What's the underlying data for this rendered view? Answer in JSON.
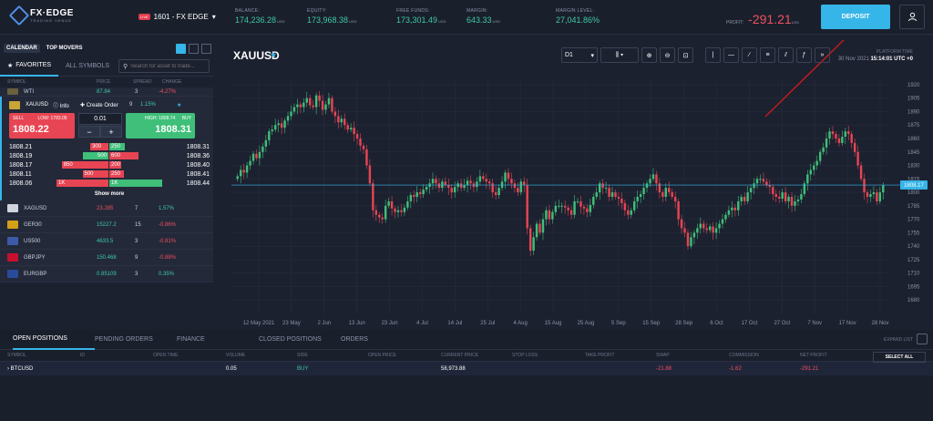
{
  "header": {
    "logo": "FX·EDGE",
    "logo_sub": "TRADING VENUE",
    "live_badge": "LIVE",
    "account": "1601 - FX EDGE",
    "balance_label": "BALANCE:",
    "balance": "174,236.28",
    "equity_label": "EQUITY:",
    "equity": "173,968.38",
    "free_funds_label": "FREE FUNDS:",
    "free_funds": "173,301.49",
    "margin_label": "MARGIN:",
    "margin": "643.33",
    "margin_level_label": "MARGIN LEVEL:",
    "margin_level": "27,041.86%",
    "currency": "USD",
    "profit_label": "PROFIT:",
    "profit": "-291.21",
    "deposit": "DEPOSIT"
  },
  "left": {
    "calendar": "CALENDAR",
    "top_movers": "TOP MOVERS",
    "favorites": "FAVORITES",
    "all_symbols": "ALL SYMBOLS",
    "search_placeholder": "Search for asset to trade...",
    "cols": [
      "SYMBOL",
      "PRICE",
      "SPREAD",
      "CHANGE"
    ],
    "wti": {
      "sym": "WTI",
      "price": "87.84",
      "spread": "3",
      "change": "-4.27%"
    },
    "xau": {
      "sym": "XAUUSD",
      "info": "Info",
      "create": "Create Order",
      "spread": "9",
      "change": "1.15%"
    },
    "sell": {
      "label": "SELL",
      "low": "LOW: 1783.05",
      "price": "1808.22"
    },
    "buy": {
      "label": "BUY",
      "high": "HIGH: 1808.74",
      "price": "1808.31"
    },
    "qty": "0.01",
    "orderbook": [
      {
        "bid": "1808.21",
        "bv": "300",
        "av": "250",
        "ask": "1808.31",
        "bw": 0.35,
        "aw": 0.3,
        "bc": "r",
        "ac": "g"
      },
      {
        "bid": "1808.19",
        "bv": "500",
        "av": "600",
        "ask": "1808.36",
        "bw": 0.5,
        "aw": 0.55,
        "bc": "g",
        "ac": "r"
      },
      {
        "bid": "1808.17",
        "bv": "850",
        "av": "200",
        "ask": "1808.40",
        "bw": 0.9,
        "aw": 0.22,
        "bc": "r",
        "ac": "r"
      },
      {
        "bid": "1808.11",
        "bv": "500",
        "av": "250",
        "ask": "1808.41",
        "bw": 0.5,
        "aw": 0.28,
        "bc": "r",
        "ac": "r"
      },
      {
        "bid": "1808.06",
        "bv": "1K",
        "av": "1K",
        "ask": "1808.44",
        "bw": 1.0,
        "aw": 1.0,
        "bc": "r",
        "ac": "g"
      }
    ],
    "show_more": "Show more",
    "rows": [
      {
        "sym": "XAGUSD",
        "price": "23.285",
        "spread": "7",
        "change": "1.57%",
        "pc": "neg",
        "cc": "pos",
        "flag": "#d0d4dc"
      },
      {
        "sym": "GER30",
        "price": "15227.2",
        "spread": "15",
        "change": "-0.86%",
        "pc": "pos",
        "cc": "neg",
        "flag": "#d4a017"
      },
      {
        "sym": "US500",
        "price": "4633.5",
        "spread": "3",
        "change": "-0.81%",
        "pc": "pos",
        "cc": "neg",
        "flag": "#3c5aa6"
      },
      {
        "sym": "GBPJPY",
        "price": "150.468",
        "spread": "9",
        "change": "-0.88%",
        "pc": "pos",
        "cc": "neg",
        "flag": "#c8102e"
      },
      {
        "sym": "EURGBP",
        "price": "0.85109",
        "spread": "3",
        "change": "0.35%",
        "pc": "pos",
        "cc": "pos",
        "flag": "#2a4a9a"
      }
    ]
  },
  "chart": {
    "symbol": "XAUUSD",
    "timeframe": "D1",
    "platform_time_label": "PLATFORM TIME",
    "platform_date": "30 Nov 2021",
    "platform_time": "15:14:01 UTC +0",
    "current": "1808.17"
  },
  "chart_data": {
    "type": "candlestick",
    "ylim": [
      1665,
      1925
    ],
    "yticks": [
      1920,
      1905,
      1890,
      1875,
      1860,
      1845,
      1830,
      1815,
      1800,
      1785,
      1770,
      1755,
      1740,
      1725,
      1710,
      1695,
      1680
    ],
    "xticks": [
      "12 May 2021",
      "23 May",
      "2 Jun",
      "13 Jun",
      "23 Jun",
      "4 Jul",
      "14 Jul",
      "25 Jul",
      "4 Aug",
      "15 Aug",
      "25 Aug",
      "5 Sep",
      "15 Sep",
      "28 Sep",
      "6 Oct",
      "17 Oct",
      "27 Oct",
      "7 Nov",
      "17 Nov",
      "28 Nov"
    ],
    "closes": [
      1818,
      1825,
      1822,
      1830,
      1835,
      1843,
      1838,
      1845,
      1851,
      1858,
      1868,
      1870,
      1875,
      1877,
      1872,
      1880,
      1885,
      1890,
      1895,
      1898,
      1895,
      1900,
      1905,
      1897,
      1895,
      1908,
      1902,
      1892,
      1898,
      1905,
      1890,
      1885,
      1878,
      1882,
      1875,
      1870,
      1872,
      1865,
      1860,
      1852,
      1848,
      1830,
      1810,
      1780,
      1775,
      1772,
      1770,
      1785,
      1790,
      1782,
      1778,
      1780,
      1778,
      1783,
      1790,
      1797,
      1795,
      1800,
      1798,
      1803,
      1806,
      1810,
      1815,
      1810,
      1805,
      1812,
      1808,
      1805,
      1800,
      1806,
      1810,
      1805,
      1808,
      1813,
      1810,
      1806,
      1812,
      1818,
      1815,
      1812,
      1810,
      1800,
      1797,
      1805,
      1812,
      1822,
      1815,
      1810,
      1805,
      1800,
      1812,
      1808,
      1760,
      1735,
      1750,
      1765,
      1755,
      1770,
      1780,
      1770,
      1778,
      1785,
      1785,
      1785,
      1783,
      1780,
      1775,
      1790,
      1790,
      1784,
      1782,
      1778,
      1786,
      1795,
      1800,
      1810,
      1805,
      1805,
      1795,
      1800,
      1795,
      1793,
      1788,
      1780,
      1775,
      1780,
      1790,
      1795,
      1798,
      1805,
      1810,
      1815,
      1820,
      1810,
      1800,
      1795,
      1805,
      1800,
      1795,
      1790,
      1770,
      1760,
      1755,
      1740,
      1750,
      1755,
      1760,
      1765,
      1760,
      1758,
      1762,
      1755,
      1760,
      1765,
      1770,
      1775,
      1780,
      1783,
      1780,
      1790,
      1795,
      1790,
      1800,
      1805,
      1810,
      1815,
      1815,
      1812,
      1808,
      1806,
      1798,
      1795,
      1793,
      1800,
      1790,
      1795,
      1785,
      1790,
      1792,
      1798,
      1810,
      1820,
      1825,
      1830,
      1835,
      1845,
      1850,
      1860,
      1868,
      1865,
      1860,
      1855,
      1862,
      1868,
      1865,
      1855,
      1845,
      1830,
      1815,
      1800,
      1795,
      1798,
      1800,
      1790,
      1800,
      1808
    ]
  },
  "bottom": {
    "tabs": [
      "OPEN POSITIONS",
      "PENDING ORDERS",
      "FINANCE",
      "CLOSED POSITIONS",
      "ORDERS"
    ],
    "expand": "EXPAND LIST",
    "select_all": "SELECT ALL",
    "cols": [
      "SYMBOL",
      "ID",
      "OPEN TIME",
      "VOLUME",
      "SIDE",
      "OPEN PRICE",
      "CURRENT PRICE",
      "STOP LOSS",
      "TAKE PROFIT",
      "SWAP",
      "COMMISSION",
      "NET PROFIT"
    ],
    "row": {
      "symbol": "BTCUSD",
      "volume": "0.05",
      "side": "BUY",
      "current": "58,973.88",
      "swap": "-21.88",
      "commission": "-1.62",
      "net": "-291.21"
    }
  }
}
